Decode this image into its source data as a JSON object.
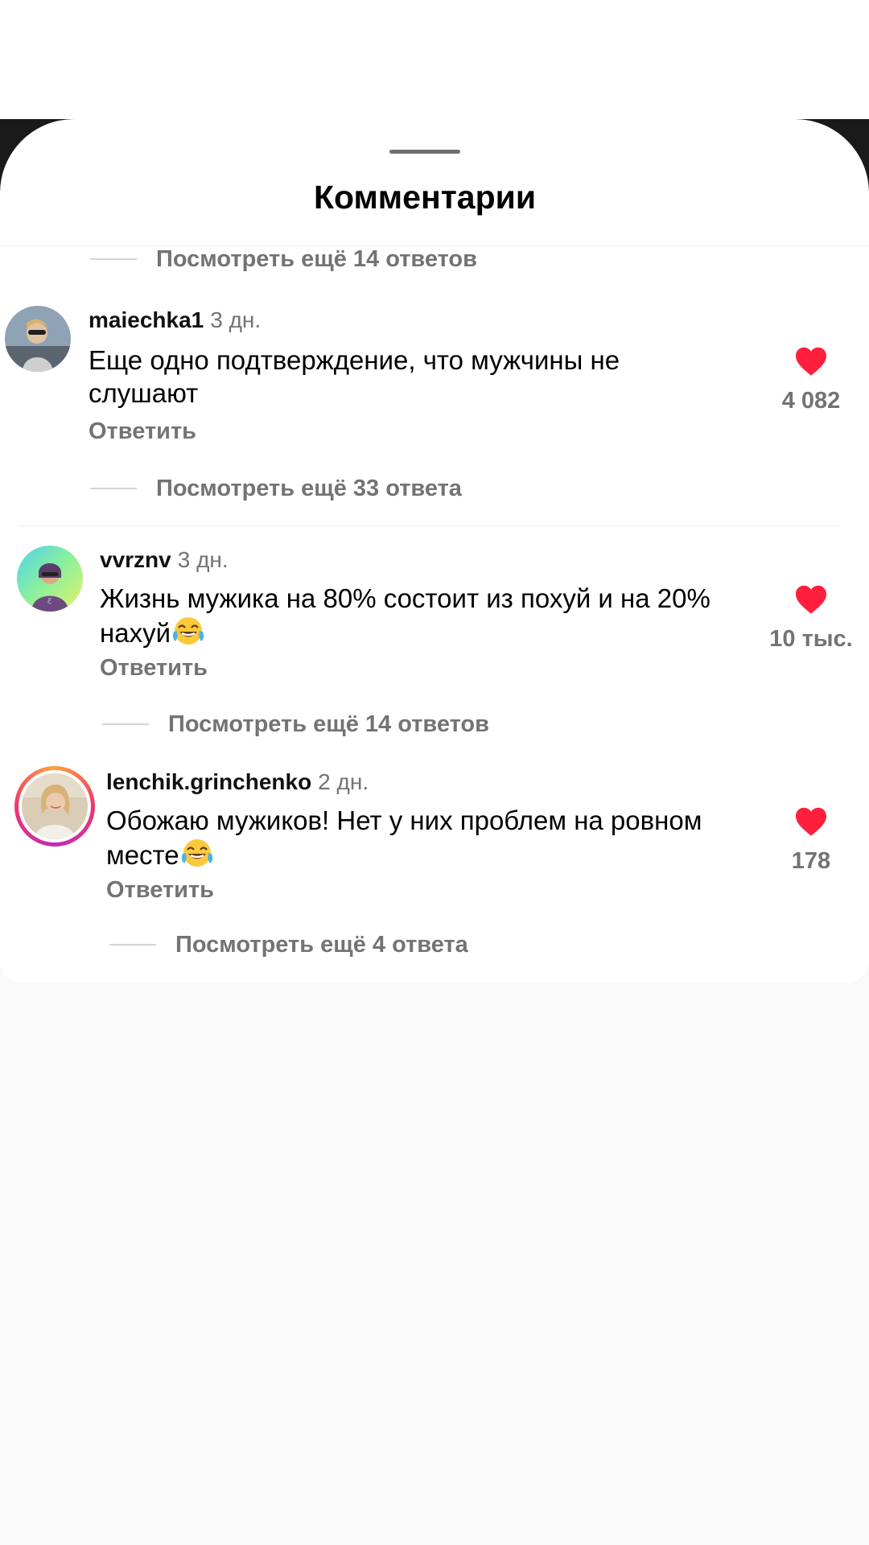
{
  "sheet": {
    "title": "Комментарии"
  },
  "top_more": {
    "label": "Посмотреть ещё 14 ответов"
  },
  "comments": [
    {
      "username": "maiechka1",
      "time": "3 дн.",
      "text": "Еще одно подтверждение, что мужчины не слушают",
      "reply_label": "Ответить",
      "likes": "4 082",
      "more_replies": "Посмотреть ещё 33 ответа",
      "avatar_icon": "avatar-photo"
    },
    {
      "username": "vvrznv",
      "time": "3 дн.",
      "text": "Жизнь мужика на 80% состоит из похуй и на 20% нахуй",
      "emoji": "face-with-tears-of-joy",
      "reply_label": "Ответить",
      "likes": "10 тыс.",
      "more_replies": "Посмотреть ещё 14 ответов",
      "avatar_icon": "avatar-photo"
    },
    {
      "username": "lenchik.grinchenko",
      "time": "2 дн.",
      "text": "Обожаю мужиков! Нет у них проблем на ровном месте",
      "emoji": "face-with-tears-of-joy",
      "reply_label": "Ответить",
      "likes": "178",
      "more_replies": "Посмотреть ещё 4 ответа",
      "avatar_icon": "avatar-photo-with-story-ring"
    }
  ],
  "colors": {
    "heart": "#ff1f3d",
    "secondary_text": "#737373",
    "story_ring": [
      "#f9a23b",
      "#f1356d",
      "#c22cb6"
    ]
  }
}
